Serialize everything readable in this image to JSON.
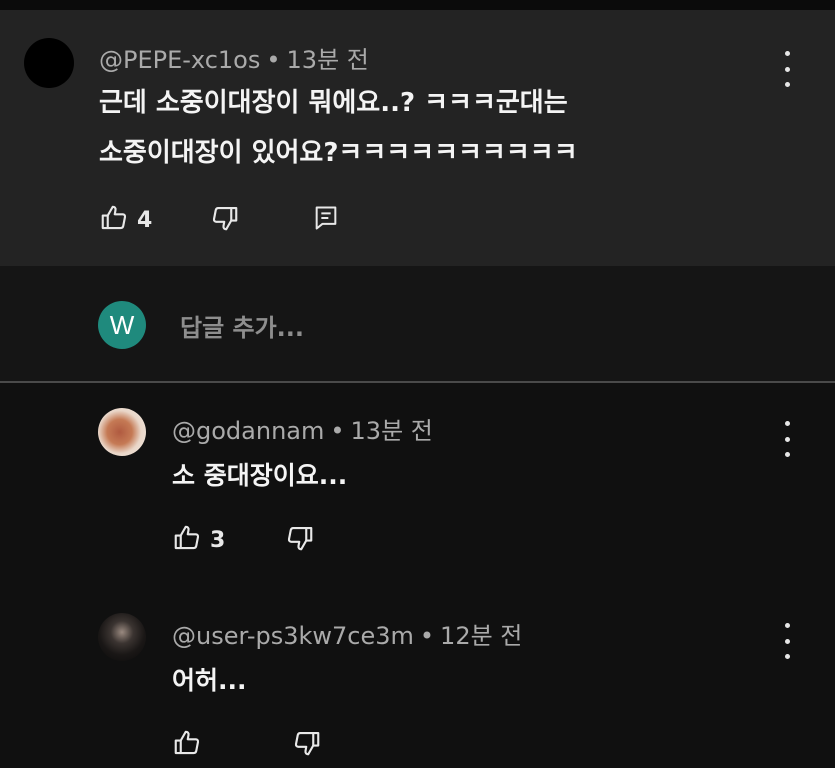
{
  "colors": {
    "background": "#101010",
    "highlighted_comment_bg": "#232323",
    "reply_avatar_w": "#1f8a7d",
    "meta_text": "#aaaaaa"
  },
  "parent_comment": {
    "author": "@PEPE-xc1os",
    "separator": "•",
    "time": "13분 전",
    "text_line1": "근데 소중이대장이 뭐에요..? ㅋㅋㅋ군대는",
    "text_line2": "소중이대장이 있어요?ㅋㅋㅋㅋㅋㅋㅋㅋㅋㅋ",
    "likes": "4"
  },
  "reply_input": {
    "avatar_letter": "W",
    "placeholder": "답글 추가..."
  },
  "replies": [
    {
      "author": "@godannam",
      "separator": "•",
      "time": "13분 전",
      "text": "소 중대장이요...",
      "likes": "3"
    },
    {
      "author": "@user-ps3kw7ce3m",
      "separator": "•",
      "time": "12분 전",
      "text": "어허...",
      "likes": ""
    }
  ]
}
